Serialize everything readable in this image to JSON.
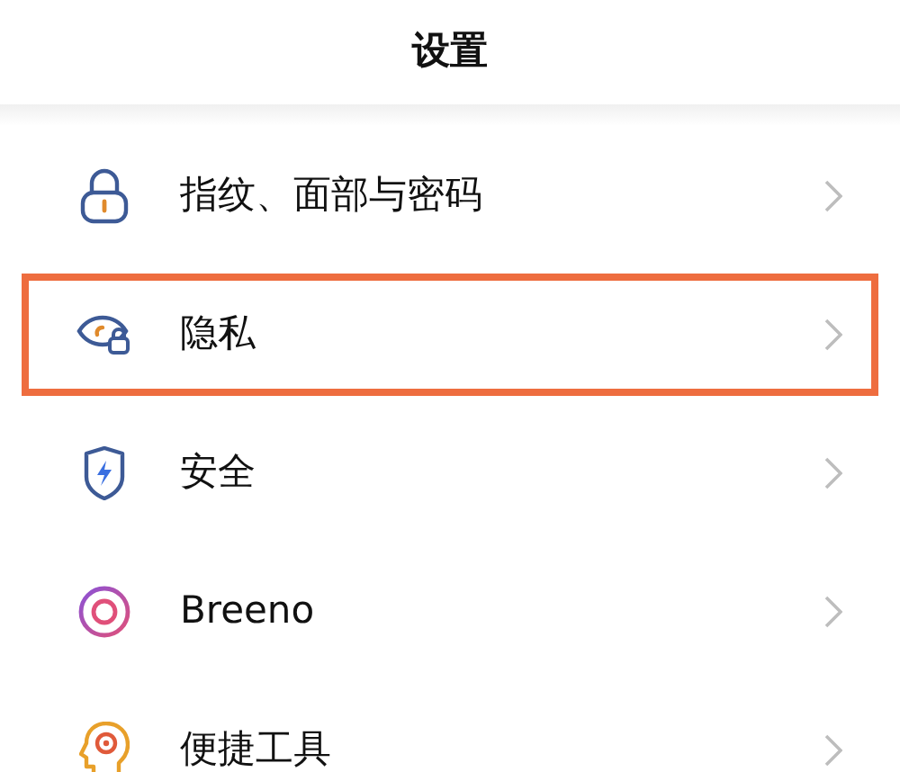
{
  "title": "设置",
  "items": [
    {
      "label": "指纹、面部与密码",
      "kind": "lock",
      "highlighted": false
    },
    {
      "label": "隐私",
      "kind": "eye",
      "highlighted": true
    },
    {
      "label": "安全",
      "kind": "shield",
      "highlighted": false
    },
    {
      "label": "Breeno",
      "kind": "ring",
      "highlighted": false
    },
    {
      "label": "便捷工具",
      "kind": "head",
      "highlighted": false
    }
  ]
}
